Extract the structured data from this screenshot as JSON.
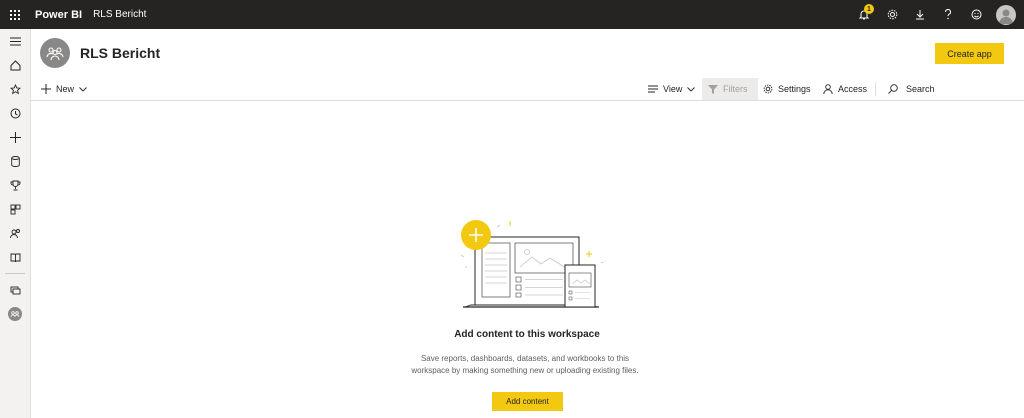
{
  "topbar": {
    "brand": "Power BI",
    "breadcrumb": "RLS Bericht",
    "notification_count": "1",
    "icons": [
      "notification-icon",
      "settings-icon",
      "download-icon",
      "help-icon",
      "feedback-icon",
      "account-avatar"
    ]
  },
  "nav": {
    "items": [
      "hamburger-icon",
      "home-icon",
      "favorites-icon",
      "recent-icon",
      "create-icon",
      "datasets-icon",
      "goals-icon",
      "apps-icon",
      "shared-icon",
      "learn-icon",
      "workspaces-icon",
      "current-workspace-icon"
    ]
  },
  "header": {
    "title": "RLS Bericht",
    "create_app": "Create app"
  },
  "toolbar": {
    "new": "New",
    "view": "View",
    "filters": "Filters",
    "settings": "Settings",
    "access": "Access",
    "search": "Search"
  },
  "empty": {
    "title": "Add content to this workspace",
    "description_line1": "Save reports, dashboards, datasets, and workbooks to this",
    "description_line2": "workspace by making something new or uploading existing files.",
    "button": "Add content"
  },
  "colors": {
    "accent": "#f2c811",
    "topbar": "#252423",
    "rail": "#f3f2f1"
  }
}
